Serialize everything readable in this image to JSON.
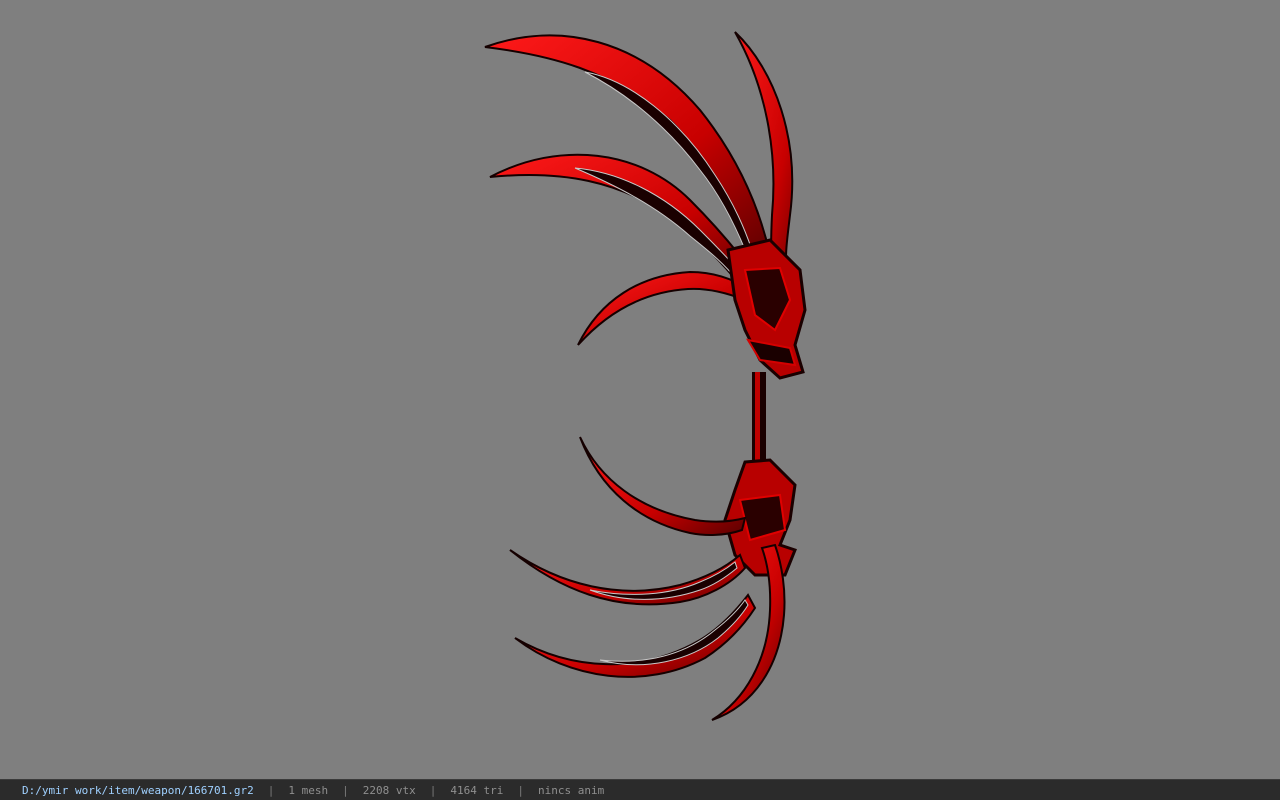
{
  "viewport": {
    "background": "#7f7f7f",
    "model": {
      "kind": "weapon-mesh",
      "primary_color": "#d40000",
      "dark_color": "#1a0000",
      "highlight_color": "#c8c8c8"
    }
  },
  "status_bar": {
    "file_path": "D:/ymir work/item/weapon/166701.gr2",
    "separator": "|",
    "mesh_count": "1 mesh",
    "vertex_count": "2208 vtx",
    "triangle_count": "4164 tri",
    "anim_status": "nincs anim",
    "path_color": "#9fd0ff",
    "text_color": "#8f8f8f",
    "background": "#2b2b2b"
  }
}
